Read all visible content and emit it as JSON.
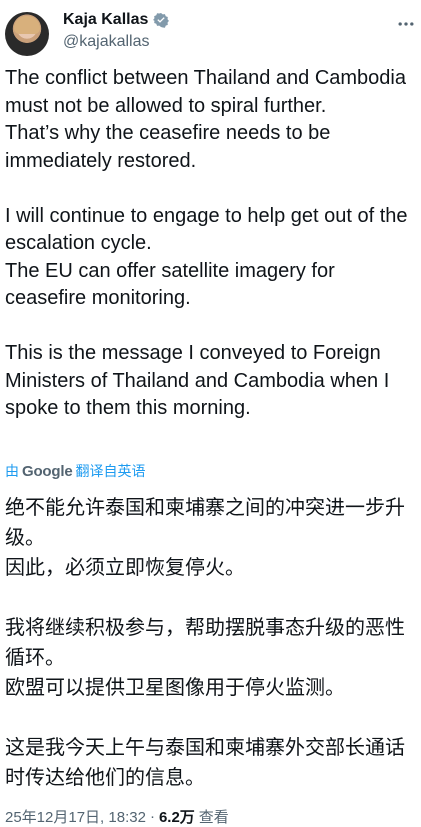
{
  "author": {
    "display_name": "Kaja Kallas",
    "handle": "@kajakallas"
  },
  "tweet": {
    "text_en": "The conflict between Thailand and Cambodia must not be allowed to spiral further.\nThat’s why the ceasefire needs to be immediately restored.\n\nI will continue to engage to help get out of the escalation cycle.\nThe EU can offer satellite imagery for ceasefire monitoring.\n\nThis is the message I conveyed to Foreign Ministers of Thailand and Cambodia when I spoke to them this morning.",
    "translation_by": "由",
    "translation_provider": "Google",
    "translation_label": "翻译自英语",
    "text_zh": "绝不能允许泰国和柬埔寨之间的冲突进一步升级。\n因此，必须立即恢复停火。\n\n我将继续积极参与，帮助摆脱事态升级的恶性循环。\n欧盟可以提供卫星图像用于停火监测。\n\n这是我今天上午与泰国和柬埔寨外交部长通话时传达给他们的信息。"
  },
  "meta": {
    "timestamp": "25年12月17日, 18:32",
    "separator": "·",
    "views_count": "6.2万",
    "views_label": "查看"
  },
  "colors": {
    "accent": "#1d9bf0",
    "secondary_text": "#536471",
    "primary_text": "#0f1419"
  }
}
